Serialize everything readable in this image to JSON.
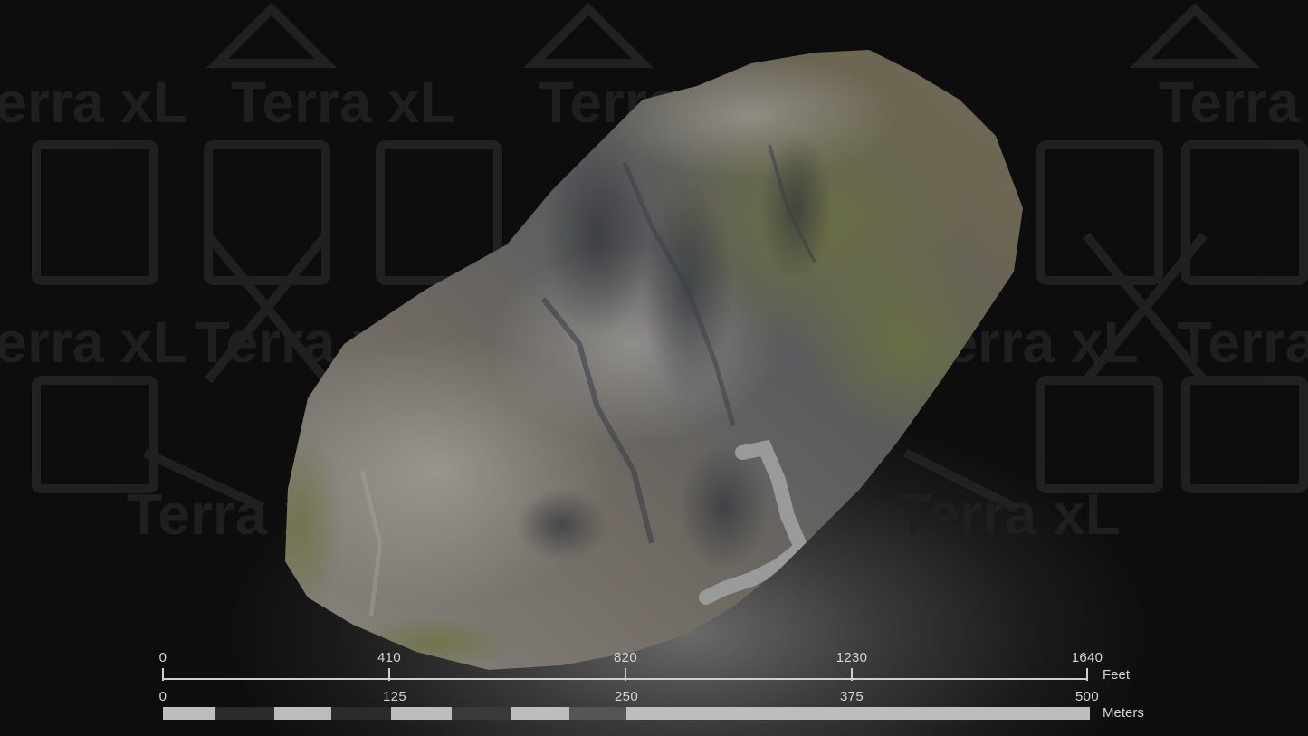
{
  "watermark": {
    "text": "Terra xL"
  },
  "scale_bar": {
    "feet": {
      "unit": "Feet",
      "ticks": [
        "0",
        "410",
        "820",
        "1230",
        "1640"
      ],
      "max": 1640
    },
    "meters": {
      "unit": "Meters",
      "ticks": [
        "0",
        "125",
        "250",
        "375",
        "500"
      ],
      "max": 500,
      "segments_fill": [
        {
          "from": 0,
          "to": 28,
          "color": "#bdbdbd"
        },
        {
          "from": 28,
          "to": 60,
          "color": "#2b2b2b"
        },
        {
          "from": 60,
          "to": 91,
          "color": "#bdbdbd"
        },
        {
          "from": 91,
          "to": 123,
          "color": "#2b2b2b"
        },
        {
          "from": 123,
          "to": 156,
          "color": "#bdbdbd"
        },
        {
          "from": 156,
          "to": 188,
          "color": "#3a3a3a"
        },
        {
          "from": 188,
          "to": 219,
          "color": "#bdbdbd"
        },
        {
          "from": 219,
          "to": 250,
          "color": "#555555"
        },
        {
          "from": 250,
          "to": 500,
          "color": "#bdbdbd"
        }
      ]
    }
  },
  "colors": {
    "background": "#0b0b0b",
    "scale": "#cfcfcf",
    "rock_gray": "#7a7d82",
    "moss": "#5e6b3a",
    "earth": "#7a6a55"
  }
}
